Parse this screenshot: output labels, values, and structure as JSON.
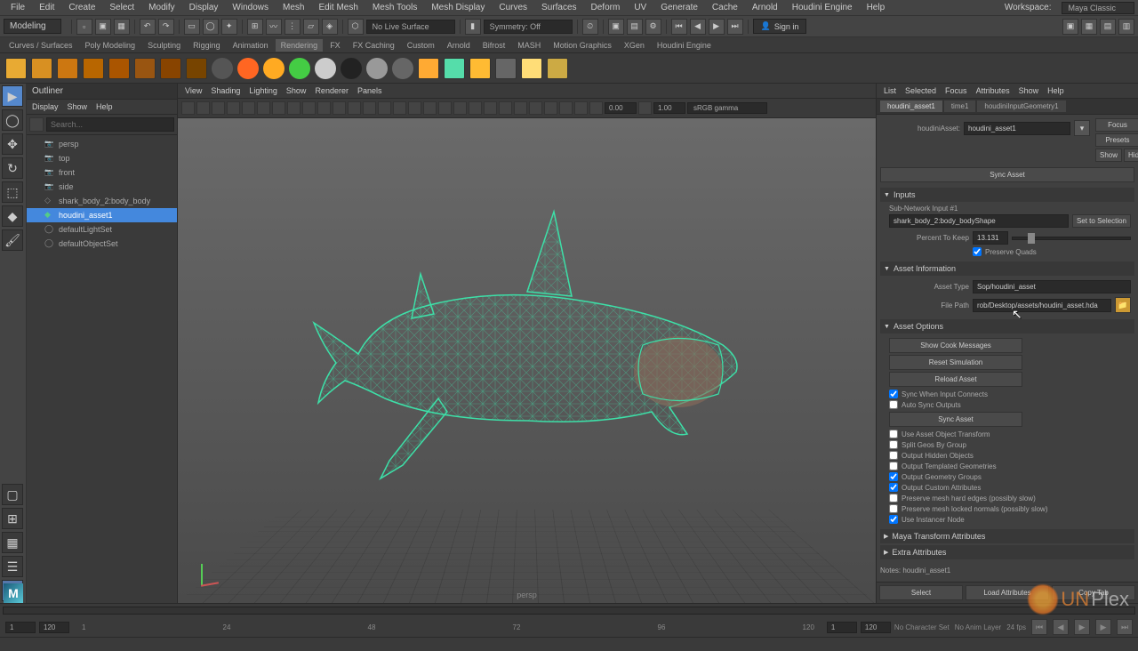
{
  "menu": [
    "File",
    "Edit",
    "Create",
    "Select",
    "Modify",
    "Display",
    "Windows",
    "Mesh",
    "Edit Mesh",
    "Mesh Tools",
    "Mesh Display",
    "Curves",
    "Surfaces",
    "Deform",
    "UV",
    "Generate",
    "Cache",
    "Arnold",
    "Houdini Engine",
    "Help"
  ],
  "workspace": {
    "label": "Workspace:",
    "value": "Maya Classic"
  },
  "mode_dropdown": "Modeling",
  "toolbar_dropdowns": {
    "live": "No Live Surface",
    "symmetry": "Symmetry: Off"
  },
  "signin": "Sign in",
  "shelf_tabs": [
    "Curves / Surfaces",
    "Poly Modeling",
    "Sculpting",
    "Rigging",
    "Animation",
    "Rendering",
    "FX",
    "FX Caching",
    "Custom",
    "Arnold",
    "Bifrost",
    "MASH",
    "Motion Graphics",
    "XGen",
    "Houdini Engine"
  ],
  "shelf_colors": [
    "#e8aa33",
    "#d89022",
    "#cc7711",
    "#b86600",
    "#aa5500",
    "#995511",
    "#884400",
    "#774400",
    "#555",
    "#ff6622",
    "#ffaa22",
    "#44cc44",
    "#ccc",
    "#222",
    "#999",
    "#666",
    "#ffaa33",
    "#55ddaa",
    "#ffbb33",
    "#666",
    "#ffdd77",
    "#ccaa44"
  ],
  "outliner": {
    "title": "Outliner",
    "menus": [
      "Display",
      "Show",
      "Help"
    ],
    "search_placeholder": "Search...",
    "items": [
      {
        "icon": "cam",
        "label": "persp"
      },
      {
        "icon": "cam",
        "label": "top"
      },
      {
        "icon": "cam",
        "label": "front"
      },
      {
        "icon": "cam",
        "label": "side"
      },
      {
        "icon": "mesh",
        "label": "shark_body_2:body_body"
      },
      {
        "icon": "asset",
        "label": "houdini_asset1",
        "selected": true
      },
      {
        "icon": "set",
        "label": "defaultLightSet"
      },
      {
        "icon": "set",
        "label": "defaultObjectSet"
      }
    ]
  },
  "viewport": {
    "menus": [
      "View",
      "Shading",
      "Lighting",
      "Show",
      "Renderer",
      "Panels"
    ],
    "val1": "0.00",
    "val2": "1.00",
    "gamma": "sRGB gamma",
    "persp": "persp"
  },
  "attr": {
    "menus": [
      "List",
      "Selected",
      "Focus",
      "Attributes",
      "Show",
      "Help"
    ],
    "tabs": [
      "houdini_asset1",
      "time1",
      "houdiniInputGeometry1"
    ],
    "active_tab": 0,
    "asset_label": "houdiniAsset:",
    "asset_value": "houdini_asset1",
    "buttons": {
      "focus": "Focus",
      "presets": "Presets",
      "show": "Show",
      "hide": "Hide",
      "sync": "Sync Asset",
      "set_sel": "Set to Selection",
      "cook_msg": "Show Cook Messages",
      "reset_sim": "Reset Simulation",
      "reload": "Reload Asset",
      "sync_asset2": "Sync Asset"
    },
    "inputs_section": "Inputs",
    "subnet_label": "Sub-Network Input #1",
    "subnet_value": "shark_body_2:body_bodyShape",
    "percent_label": "Percent To Keep",
    "percent_value": "13.131",
    "preserve_quads": "Preserve Quads",
    "asset_info_section": "Asset Information",
    "asset_type_label": "Asset Type",
    "asset_type_value": "Sop/houdini_asset",
    "file_path_label": "File Path",
    "file_path_value": "rob/Desktop/assets/houdini_asset.hda",
    "asset_options_section": "Asset Options",
    "options": [
      {
        "label": "Sync When Input Connects",
        "checked": true
      },
      {
        "label": "Auto Sync Outputs",
        "checked": false
      },
      {
        "label": "Use Asset Object Transform",
        "checked": false
      },
      {
        "label": "Split Geos By Group",
        "checked": false
      },
      {
        "label": "Output Hidden Objects",
        "checked": false
      },
      {
        "label": "Output Templated Geometries",
        "checked": false
      },
      {
        "label": "Output Geometry Groups",
        "checked": true
      },
      {
        "label": "Output Custom Attributes",
        "checked": true
      },
      {
        "label": "Preserve mesh hard edges (possibly slow)",
        "checked": false
      },
      {
        "label": "Preserve mesh locked normals (possibly slow)",
        "checked": false
      },
      {
        "label": "Use Instancer Node",
        "checked": true
      }
    ],
    "maya_transform": "Maya Transform Attributes",
    "extra_attrs": "Extra Attributes",
    "notes_label": "Notes: houdini_asset1",
    "footer": [
      "Select",
      "Load Attributes",
      "Copy Tab"
    ]
  },
  "timeline": {
    "start": "1",
    "end": "120",
    "current": "1",
    "ticks": [
      "1",
      "120",
      "1",
      "120"
    ],
    "info": [
      "No Character Set",
      "No Anim Layer",
      "24 fps"
    ]
  },
  "watermark": {
    "text1": "UN",
    "text2": "Plex"
  }
}
